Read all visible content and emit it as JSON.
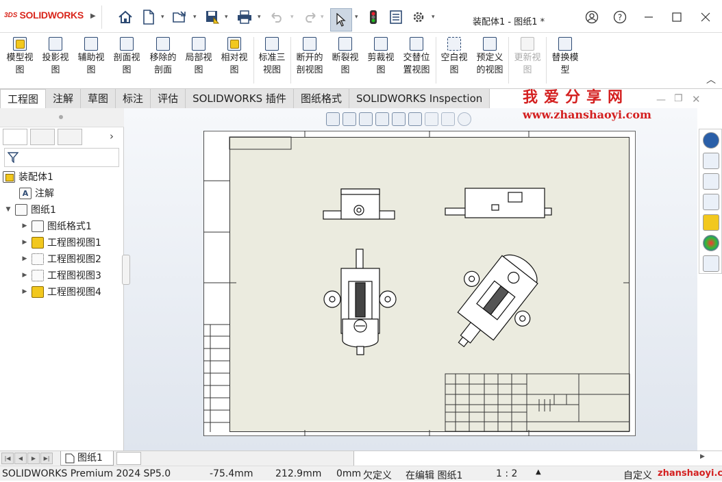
{
  "app": {
    "brand_prefix": "3DS",
    "brand": "SOLIDWORKS"
  },
  "titlebar": {
    "document_title": "装配体1 - 图纸1 *"
  },
  "quick_access": [
    "home-icon",
    "new-icon",
    "open-icon",
    "save-icon",
    "print-icon",
    "undo-icon",
    "redo-icon",
    "select-icon",
    "rebuild-icon",
    "file-properties-icon",
    "options-icon"
  ],
  "ribbon": {
    "buttons": [
      {
        "l1": "模型视",
        "l2": "图"
      },
      {
        "l1": "投影视",
        "l2": "图"
      },
      {
        "l1": "辅助视",
        "l2": "图"
      },
      {
        "l1": "剖面视",
        "l2": "图"
      },
      {
        "l1": "移除的",
        "l2": "剖面"
      },
      {
        "l1": "局部视",
        "l2": "图"
      },
      {
        "l1": "相对视",
        "l2": "图"
      },
      {
        "l1": "标准三",
        "l2": "视图"
      },
      {
        "l1": "断开的",
        "l2": "剖视图"
      },
      {
        "l1": "断裂视",
        "l2": "图"
      },
      {
        "l1": "剪裁视",
        "l2": "图"
      },
      {
        "l1": "交替位",
        "l2": "置视图"
      },
      {
        "l1": "空白视",
        "l2": "图"
      },
      {
        "l1": "预定义",
        "l2": "的视图"
      },
      {
        "l1": "更新视",
        "l2": "图"
      },
      {
        "l1": "替换模",
        "l2": "型"
      }
    ]
  },
  "tabs": [
    "工程图",
    "注解",
    "草图",
    "标注",
    "评估",
    "SOLIDWORKS 插件",
    "图纸格式",
    "SOLIDWORKS Inspection"
  ],
  "watermark": {
    "title": "我爱分享网",
    "url": "www.zhanshaoyi.com",
    "footer": "zhanshaoyi.com"
  },
  "tree": {
    "root": "装配体1",
    "items": [
      {
        "label": "注解"
      },
      {
        "label": "图纸1"
      },
      {
        "label": "图纸格式1"
      },
      {
        "label": "工程图视图1"
      },
      {
        "label": "工程图视图2"
      },
      {
        "label": "工程图视图3"
      },
      {
        "label": "工程图视图4"
      }
    ]
  },
  "sheet_tab": "图纸1",
  "status": {
    "product": "SOLIDWORKS Premium 2024 SP5.0",
    "x": "-75.4mm",
    "y": "212.9mm",
    "z": "0mm",
    "defined": "欠定义",
    "editing": "在编辑 图纸1",
    "scale": "1 : 2",
    "units": "自定义"
  },
  "colors": {
    "brand_red": "#d9261c",
    "sheet_bg": "#ebebdf",
    "watermark_red": "#d42020"
  }
}
